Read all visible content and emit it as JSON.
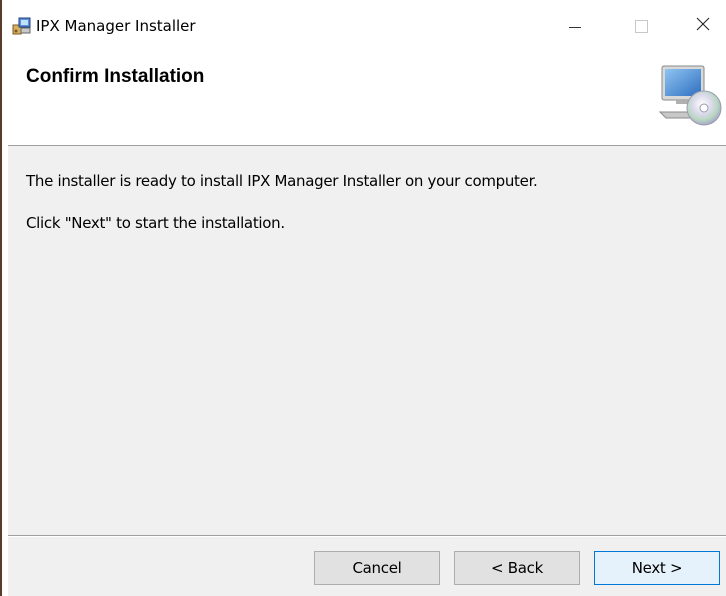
{
  "window": {
    "title": "IPX Manager Installer"
  },
  "banner": {
    "title": "Confirm Installation"
  },
  "body": {
    "line1": "The installer is ready to install IPX Manager Installer on your computer.",
    "line2": "Click \"Next\" to start the installation."
  },
  "buttons": {
    "cancel": "Cancel",
    "back": "< Back",
    "next": "Next >"
  },
  "icons": {
    "app": "installer-package-icon",
    "banner": "computer-cd-icon",
    "minimize": "minimize-icon",
    "maximize": "maximize-icon",
    "close": "close-icon"
  },
  "colors": {
    "focus_border": "#0078d7",
    "button_face": "#e1e1e1",
    "dialog_background": "#f0f0f0"
  }
}
